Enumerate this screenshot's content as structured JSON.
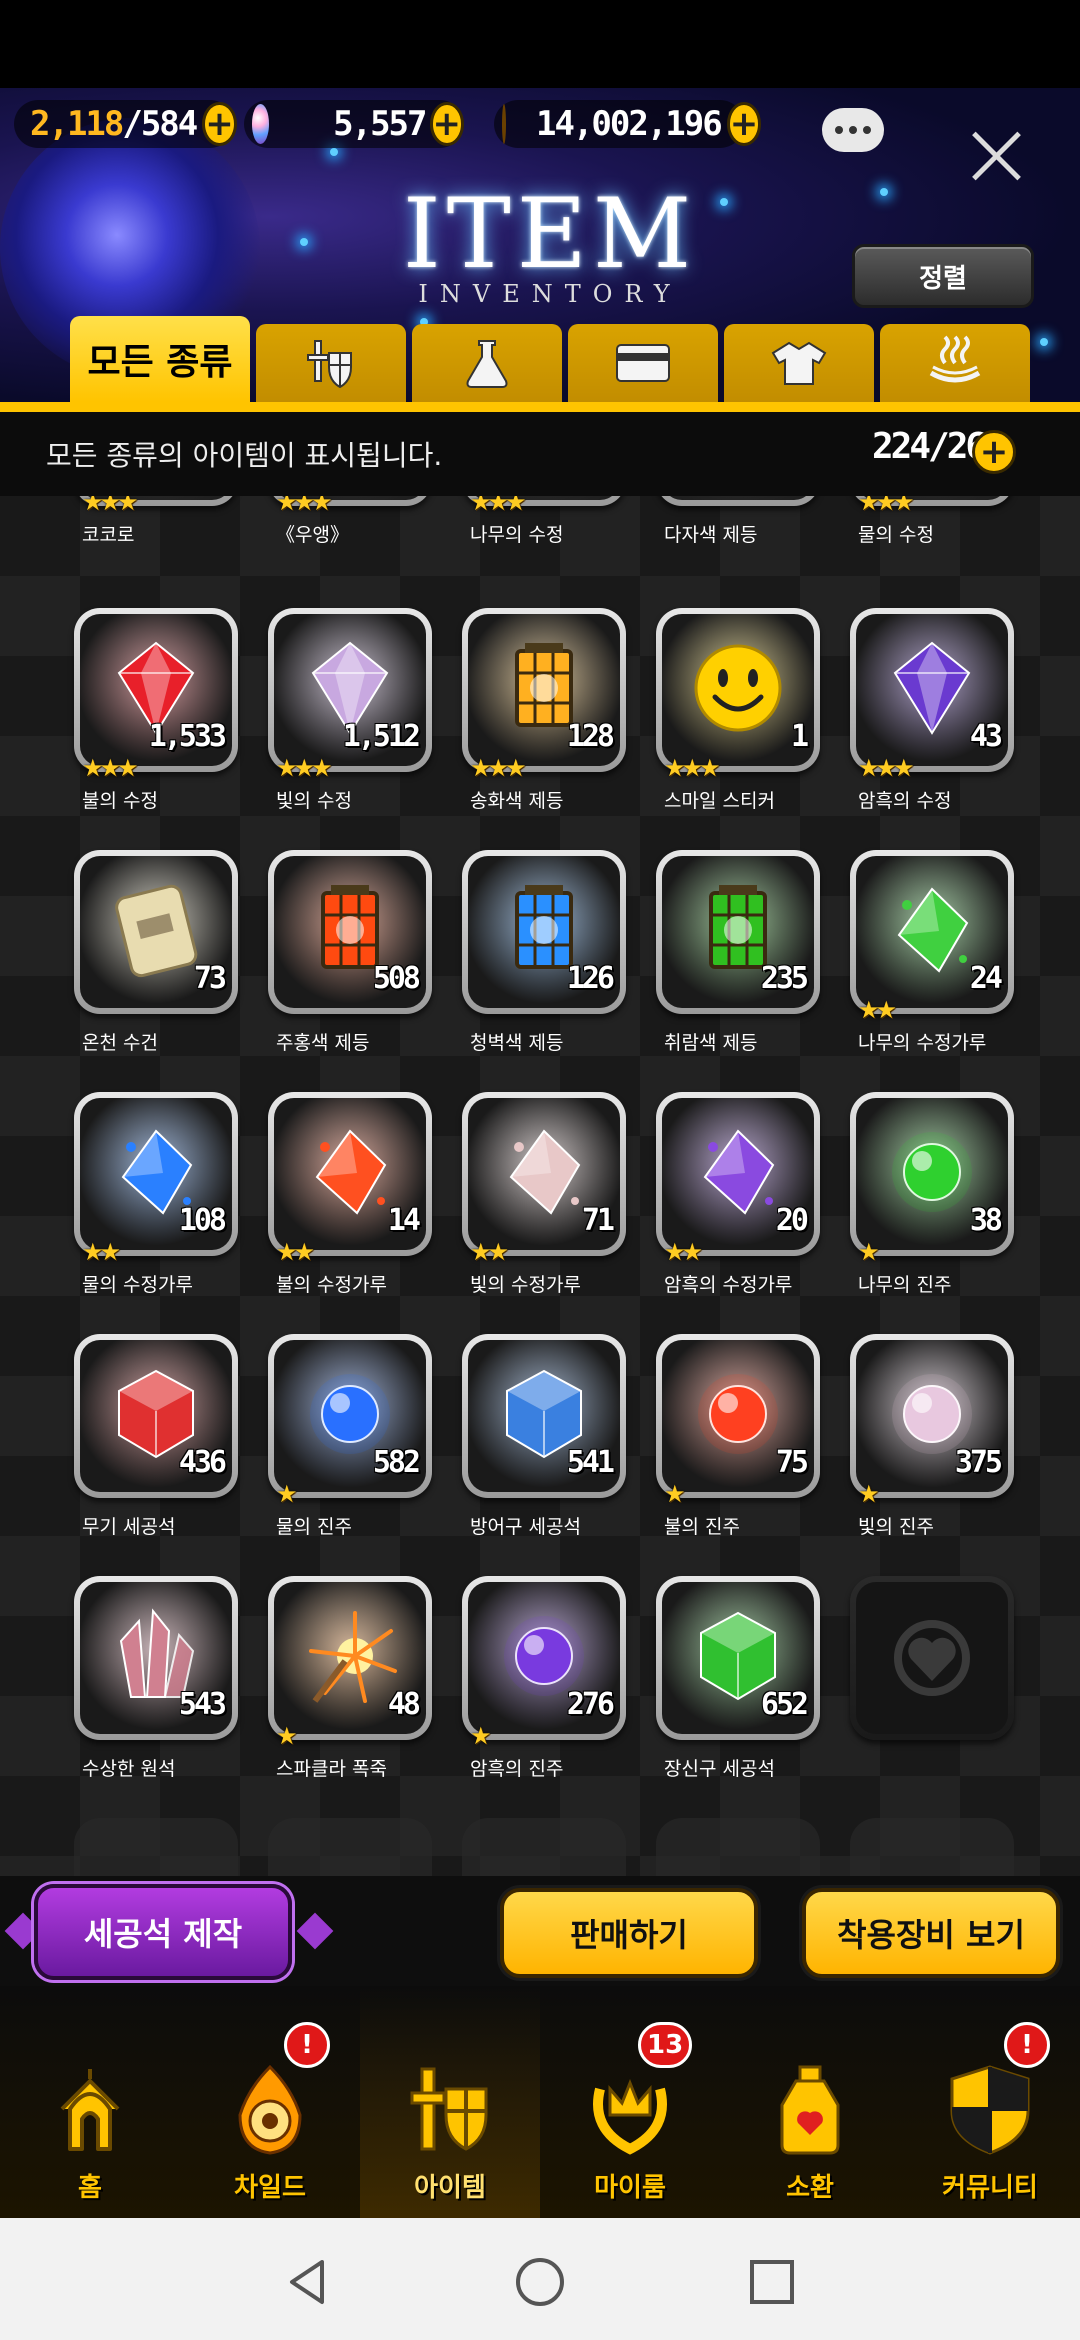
{
  "resources": {
    "stamina_current": "2,118",
    "stamina_max": "/584",
    "gems": "5,557",
    "gold": "14,002,196"
  },
  "header": {
    "title": "ITEM",
    "subtitle": "INVENTORY",
    "sort_label": "정렬"
  },
  "tabs": [
    {
      "label": "모든 종류",
      "icon": "all-icon"
    },
    {
      "label": "",
      "icon": "equipment-icon"
    },
    {
      "label": "",
      "icon": "flask-icon"
    },
    {
      "label": "",
      "icon": "card-icon"
    },
    {
      "label": "",
      "icon": "costume-icon"
    },
    {
      "label": "",
      "icon": "hot-spring-icon"
    }
  ],
  "info": {
    "message": "모든 종류의 아이템이 표시됩니다.",
    "count": "224/260"
  },
  "partial_row": [
    {
      "name": "코코로",
      "stars": 3
    },
    {
      "name": "《우앵》",
      "stars": 3
    },
    {
      "name": "나무의 수정",
      "stars": 3
    },
    {
      "name": "다자색 제등",
      "stars": 0
    },
    {
      "name": "물의 수정",
      "stars": 3
    }
  ],
  "items": [
    {
      "name": "불의 수정",
      "qty": "1,533",
      "stars": 3,
      "art": "crystal",
      "color": "#e8202a"
    },
    {
      "name": "빛의 수정",
      "qty": "1,512",
      "stars": 3,
      "art": "crystal",
      "color": "#c8a8e0"
    },
    {
      "name": "송화색 제등",
      "qty": "128",
      "stars": 3,
      "art": "lantern",
      "color": "#ffb020"
    },
    {
      "name": "스마일 스티커",
      "qty": "1",
      "stars": 3,
      "art": "smiley",
      "color": "#ffd000"
    },
    {
      "name": "암흑의 수정",
      "qty": "43",
      "stars": 3,
      "art": "crystal",
      "color": "#6a3ad0"
    },
    {
      "name": "온천 수건",
      "qty": "73",
      "stars": 0,
      "art": "towel",
      "color": "#e8dcb0"
    },
    {
      "name": "주홍색 제등",
      "qty": "508",
      "stars": 0,
      "art": "lantern",
      "color": "#ff4a10"
    },
    {
      "name": "청벽색 제등",
      "qty": "126",
      "stars": 0,
      "art": "lantern",
      "color": "#2a90ff"
    },
    {
      "name": "취람색 제등",
      "qty": "235",
      "stars": 0,
      "art": "lantern",
      "color": "#30c020"
    },
    {
      "name": "나무의 수정가루",
      "qty": "24",
      "stars": 2,
      "art": "shard",
      "color": "#40d040"
    },
    {
      "name": "물의 수정가루",
      "qty": "108",
      "stars": 2,
      "art": "shard",
      "color": "#2a80ff"
    },
    {
      "name": "불의 수정가루",
      "qty": "14",
      "stars": 2,
      "art": "shard",
      "color": "#ff5020"
    },
    {
      "name": "빛의 수정가루",
      "qty": "71",
      "stars": 2,
      "art": "shard",
      "color": "#e8c8c8"
    },
    {
      "name": "암흑의 수정가루",
      "qty": "20",
      "stars": 2,
      "art": "shard",
      "color": "#8a4ae0"
    },
    {
      "name": "나무의 진주",
      "qty": "38",
      "stars": 1,
      "art": "pearl",
      "color": "#30d030"
    },
    {
      "name": "무기 세공석",
      "qty": "436",
      "stars": 0,
      "art": "cube",
      "color": "#e03030"
    },
    {
      "name": "물의 진주",
      "qty": "582",
      "stars": 1,
      "art": "pearl",
      "color": "#2a70ff"
    },
    {
      "name": "방어구 세공석",
      "qty": "541",
      "stars": 0,
      "art": "cube",
      "color": "#3a80e0"
    },
    {
      "name": "불의 진주",
      "qty": "75",
      "stars": 1,
      "art": "pearl",
      "color": "#ff4020"
    },
    {
      "name": "빛의 진주",
      "qty": "375",
      "stars": 1,
      "art": "pearl",
      "color": "#e8c8e0"
    },
    {
      "name": "수상한 원석",
      "qty": "543",
      "stars": 0,
      "art": "cluster",
      "color": "#d08090"
    },
    {
      "name": "스파클라 폭죽",
      "qty": "48",
      "stars": 1,
      "art": "firework",
      "color": "#ff8a20"
    },
    {
      "name": "암흑의 진주",
      "qty": "276",
      "stars": 1,
      "art": "pearl",
      "color": "#7a3ae0"
    },
    {
      "name": "장신구 세공석",
      "qty": "652",
      "stars": 0,
      "art": "cube",
      "color": "#30c030"
    }
  ],
  "actions": {
    "craft": "세공석 제작",
    "sell": "판매하기",
    "equipped": "착용장비 보기"
  },
  "nav": [
    {
      "label": "홈",
      "icon": "home-icon",
      "badge": ""
    },
    {
      "label": "차일드",
      "icon": "child-icon",
      "badge": "!"
    },
    {
      "label": "아이템",
      "icon": "item-icon",
      "badge": ""
    },
    {
      "label": "마이룸",
      "icon": "myroom-icon",
      "badge": "13"
    },
    {
      "label": "소환",
      "icon": "summon-icon",
      "badge": ""
    },
    {
      "label": "커뮤니티",
      "icon": "community-icon",
      "badge": "!"
    }
  ],
  "colors": {
    "accent_gold": "#ffc400",
    "craft_purple": "#9a2ad0",
    "star": "#ffcc22",
    "badge_red": "#e01818"
  }
}
